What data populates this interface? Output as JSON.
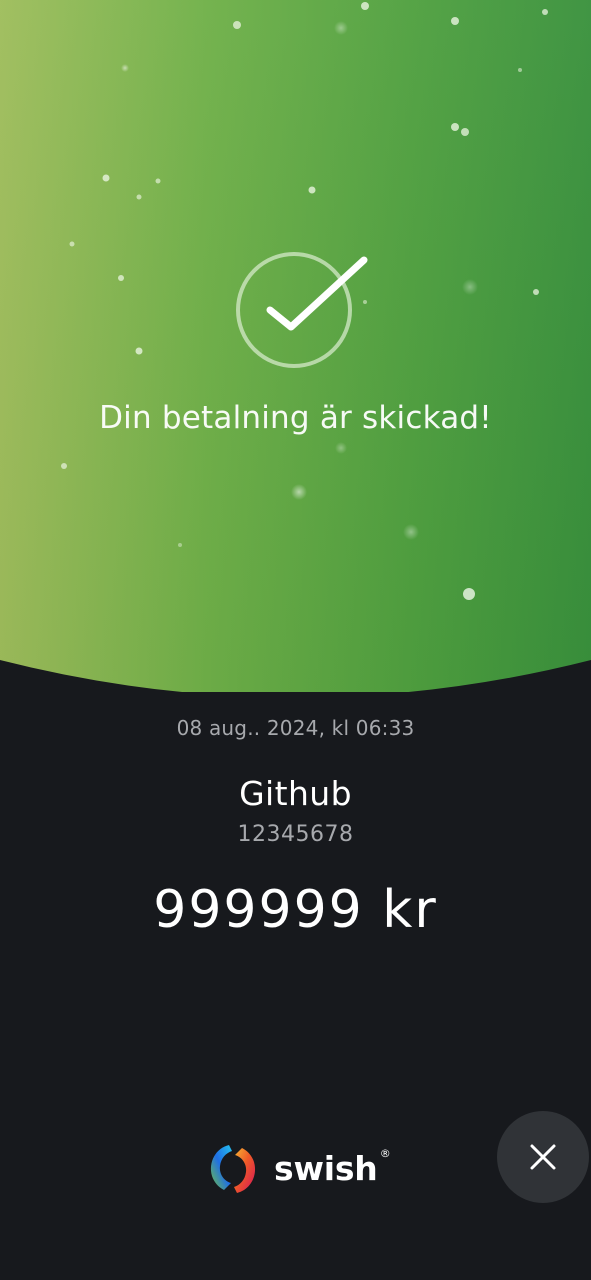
{
  "success": {
    "title": "Din betalning är skickad!",
    "icon": "checkmark-circle-icon"
  },
  "payment": {
    "timestamp": "08 aug.. 2024, kl 06:33",
    "recipient_name": "Github",
    "recipient_number": "12345678",
    "amount": "999999 kr"
  },
  "brand": {
    "name": "swish",
    "trademark": "®",
    "icon": "swish-logo-icon"
  },
  "actions": {
    "close_icon": "close-icon"
  },
  "colors": {
    "gradient_start": "#9ebd5b",
    "gradient_mid": "#5ea941",
    "gradient_end": "#39913c",
    "background": "#17191d",
    "close_button": "#303337"
  }
}
